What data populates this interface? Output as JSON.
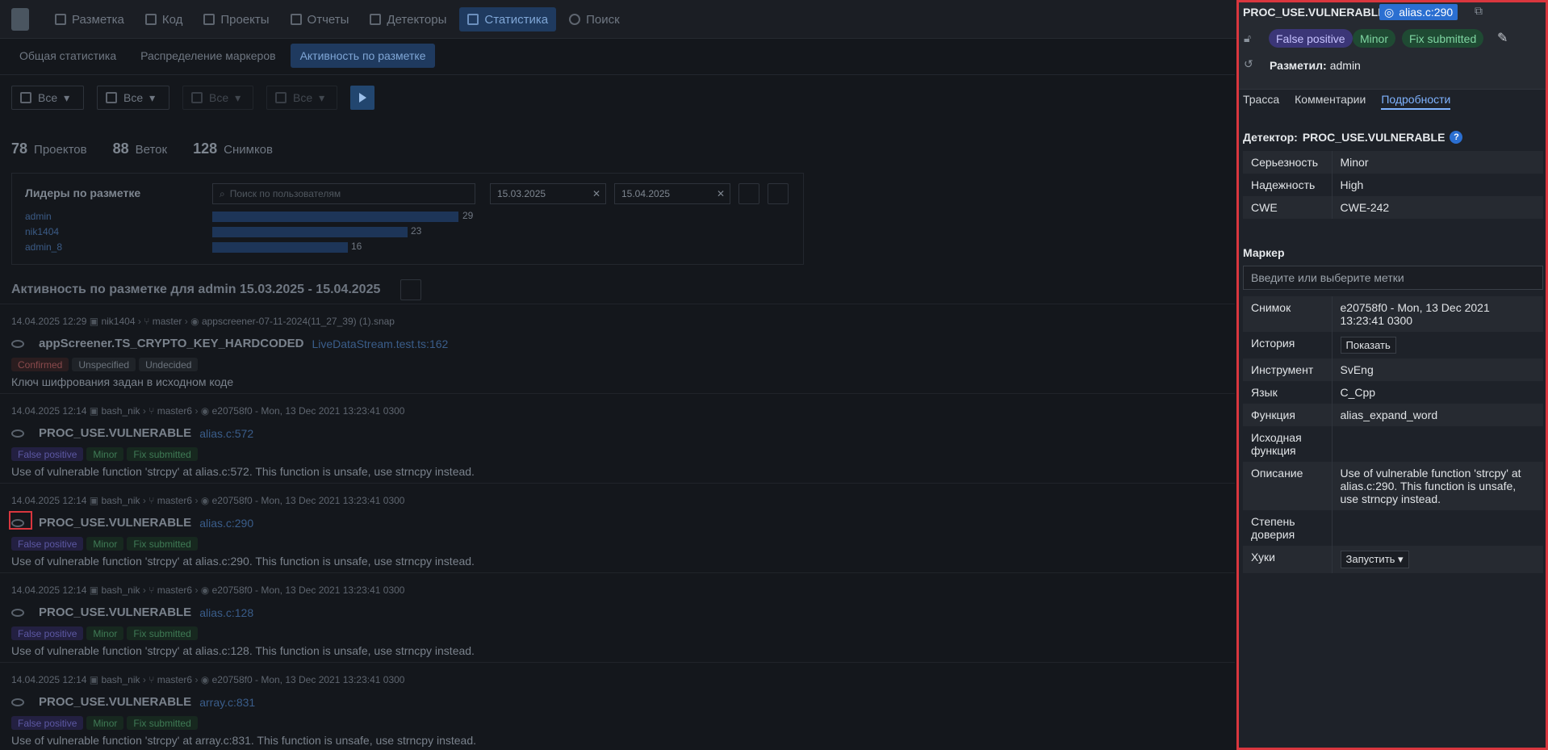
{
  "nav": {
    "items": [
      "Разметка",
      "Код",
      "Проекты",
      "Отчеты",
      "Детекторы",
      "Статистика",
      "Поиск"
    ],
    "active": "Статистика"
  },
  "subnav": {
    "tabs": [
      "Общая статистика",
      "Распределение маркеров",
      "Активность по разметке"
    ],
    "active": "Активность по разметке"
  },
  "filters": [
    "Все",
    "Все",
    "Все",
    "Все"
  ],
  "counts": [
    {
      "n": "78",
      "label": "Проектов"
    },
    {
      "n": "88",
      "label": "Веток"
    },
    {
      "n": "128",
      "label": "Снимков"
    }
  ],
  "leaders": {
    "title": "Лидеры по разметке",
    "search_placeholder": "Поиск по пользователям",
    "date_from": "15.03.2025",
    "date_to": "15.04.2025",
    "rows": [
      {
        "user": "admin",
        "value": 29
      },
      {
        "user": "nik1404",
        "value": 23
      },
      {
        "user": "admin_8",
        "value": 16
      }
    ]
  },
  "activity_title": "Активность по разметке для admin 15.03.2025 - 15.04.2025",
  "entries": [
    {
      "date": "14.04.2025 12:29",
      "user": "nik1404",
      "branch": "master",
      "snap": "appscreener-07-11-2024(11_27_39) (1).snap",
      "name": "appScreener.TS_CRYPTO_KEY_HARDCODED",
      "loc": "LiveDataStream.test.ts:162",
      "tags": [
        "Confirmed",
        "Unspecified",
        "Undecided"
      ],
      "desc": "Ключ шифрования задан в исходном коде"
    },
    {
      "date": "14.04.2025 12:14",
      "user": "bash_nik",
      "branch": "master6",
      "snap": "e20758f0 - Mon, 13 Dec 2021 13:23:41 0300",
      "name": "PROC_USE.VULNERABLE",
      "loc": "alias.c:572",
      "tags": [
        "False positive",
        "Minor",
        "Fix submitted"
      ],
      "desc": "Use of vulnerable function 'strcpy' at alias.c:572. This function is unsafe, use strncpy instead."
    },
    {
      "date": "14.04.2025 12:14",
      "user": "bash_nik",
      "branch": "master6",
      "snap": "e20758f0 - Mon, 13 Dec 2021 13:23:41 0300",
      "name": "PROC_USE.VULNERABLE",
      "loc": "alias.c:290",
      "tags": [
        "False positive",
        "Minor",
        "Fix submitted"
      ],
      "desc": "Use of vulnerable function 'strcpy' at alias.c:290. This function is unsafe, use strncpy instead."
    },
    {
      "date": "14.04.2025 12:14",
      "user": "bash_nik",
      "branch": "master6",
      "snap": "e20758f0 - Mon, 13 Dec 2021 13:23:41 0300",
      "name": "PROC_USE.VULNERABLE",
      "loc": "alias.c:128",
      "tags": [
        "False positive",
        "Minor",
        "Fix submitted"
      ],
      "desc": "Use of vulnerable function 'strcpy' at alias.c:128. This function is unsafe, use strncpy instead."
    },
    {
      "date": "14.04.2025 12:14",
      "user": "bash_nik",
      "branch": "master6",
      "snap": "e20758f0 - Mon, 13 Dec 2021 13:23:41 0300",
      "name": "PROC_USE.VULNERABLE",
      "loc": "array.c:831",
      "tags": [
        "False positive",
        "Minor",
        "Fix submitted"
      ],
      "desc": "Use of vulnerable function 'strcpy' at array.c:831. This function is unsafe, use strncpy instead."
    }
  ],
  "panel": {
    "title": "PROC_USE.VULNERABLE",
    "alias": "alias.c:290",
    "pills": [
      "False positive",
      "Minor",
      "Fix submitted"
    ],
    "marker_label": "Разметил:",
    "marker_user": "admin",
    "tabs": [
      "Трасса",
      "Комментарии",
      "Подробности"
    ],
    "active_tab": "Подробности",
    "detector_label": "Детектор:",
    "detector": "PROC_USE.VULNERABLE",
    "props": [
      {
        "k": "Серьезность",
        "v": "Minor"
      },
      {
        "k": "Надежность",
        "v": "High"
      },
      {
        "k": "CWE",
        "v": "CWE-242"
      }
    ],
    "marker_title": "Маркер",
    "marker_placeholder": "Введите или выберите метки",
    "details": [
      {
        "k": "Снимок",
        "v": "e20758f0 - Mon, 13 Dec 2021 13:23:41 0300"
      },
      {
        "k": "История",
        "v": "Показать"
      },
      {
        "k": "Инструмент",
        "v": "SvEng"
      },
      {
        "k": "Язык",
        "v": "C_Cpp"
      },
      {
        "k": "Функция",
        "v": "alias_expand_word"
      },
      {
        "k": "Исходная функция",
        "v": ""
      },
      {
        "k": "Описание",
        "v": "Use of vulnerable function 'strcpy' at alias.c:290. This function is unsafe, use strncpy instead."
      },
      {
        "k": "Степень доверия",
        "v": ""
      },
      {
        "k": "Хуки",
        "v": "Запустить"
      }
    ]
  }
}
